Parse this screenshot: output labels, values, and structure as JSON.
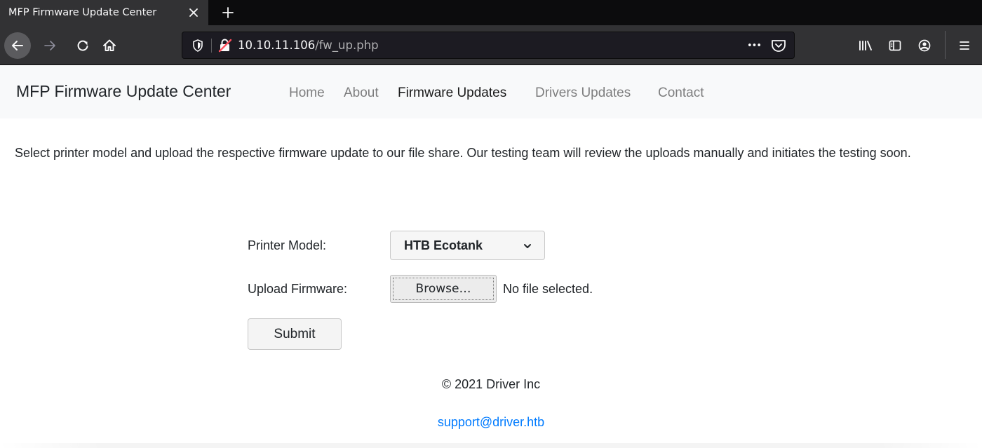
{
  "browser": {
    "tab_title": "MFP Firmware Update Center",
    "url_host": "10.10.11.106",
    "url_path": "/fw_up.php",
    "more_label": "•••"
  },
  "site": {
    "brand": "MFP Firmware Update Center",
    "nav": [
      "Home",
      "About",
      "Firmware Updates",
      "Drivers Updates",
      "Contact"
    ],
    "active_nav": "Firmware Updates"
  },
  "main": {
    "intro": "Select printer model and upload the respective firmware update to our file share. Our testing team will review the uploads manually and initiates the testing soon.",
    "form": {
      "model_label": "Printer Model:",
      "model_value": "HTB Ecotank",
      "upload_label": "Upload Firmware:",
      "browse_label": "Browse…",
      "file_status": "No file selected.",
      "submit_label": "Submit"
    }
  },
  "footer": {
    "copyright": "© 2021 Driver Inc",
    "email": "support@driver.htb"
  },
  "colors": {
    "chrome_bg": "#323234",
    "tabstrip_bg": "#0c0c0d",
    "urlbar_bg": "#1c1b22",
    "nav_bg": "#f8f9fa",
    "link": "#007bff",
    "insecure_icon": "#ff4f5e"
  },
  "icons": {
    "tab_close": "close-icon",
    "new_tab": "plus-icon",
    "back": "arrow-left-icon",
    "forward": "arrow-right-icon",
    "reload": "reload-icon",
    "home": "home-icon",
    "tracking": "shield-icon",
    "insecure": "insecure-lock-icon",
    "pocket": "pocket-icon",
    "library": "library-icon",
    "sidebar": "sidebar-icon",
    "account": "account-icon",
    "menu": "hamburger-menu-icon",
    "select": "chevron-down-icon"
  }
}
